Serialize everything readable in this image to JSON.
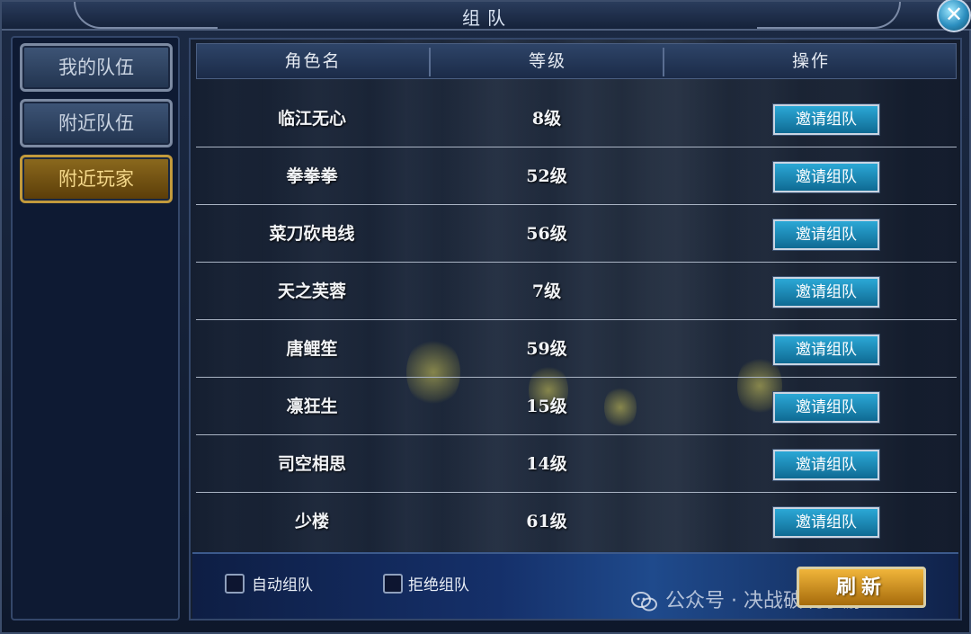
{
  "window": {
    "title": "组队",
    "close_label": "✕"
  },
  "sidebar": {
    "tabs": [
      {
        "label": "我的队伍",
        "active": false
      },
      {
        "label": "附近队伍",
        "active": false
      },
      {
        "label": "附近玩家",
        "active": true
      }
    ]
  },
  "table": {
    "headers": [
      "角色名",
      "等级",
      "操作"
    ],
    "rows": [
      {
        "name": "临江无心",
        "level": "8级",
        "action": "邀请组队"
      },
      {
        "name": "拳拳拳",
        "level": "52级",
        "action": "邀请组队"
      },
      {
        "name": "菜刀砍电线",
        "level": "56级",
        "action": "邀请组队"
      },
      {
        "name": "天之芙蓉",
        "level": "7级",
        "action": "邀请组队"
      },
      {
        "name": "唐鲤笙",
        "level": "59级",
        "action": "邀请组队"
      },
      {
        "name": "凛狂生",
        "level": "15级",
        "action": "邀请组队"
      },
      {
        "name": "司空相思",
        "level": "14级",
        "action": "邀请组队"
      },
      {
        "name": "少楼",
        "level": "61级",
        "action": "邀请组队"
      }
    ]
  },
  "footer": {
    "auto_team_label": "自动组队",
    "reject_team_label": "拒绝组队",
    "refresh_label": "刷新",
    "watermark": "公众号 · 决战破晓手游"
  },
  "colors": {
    "accent_invite": "#1e8ab8",
    "active_tab": "#8c6a1e",
    "refresh": "#f0b53a"
  }
}
